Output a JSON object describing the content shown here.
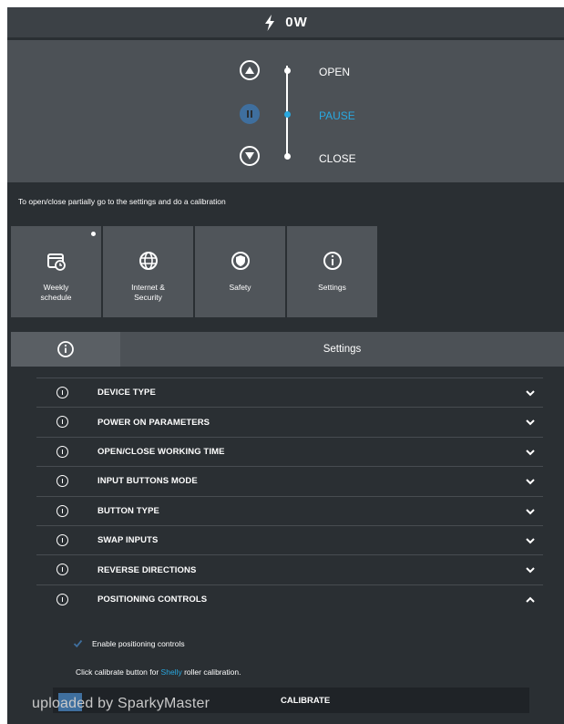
{
  "power": {
    "value": "0W"
  },
  "control": {
    "open_label": "OPEN",
    "pause_label": "PAUSE",
    "close_label": "CLOSE",
    "active": "PAUSE"
  },
  "note": "To open/close partially go to the settings and do a calibration",
  "tiles": [
    {
      "label": "Weekly\nschedule",
      "icon": "calendar-icon"
    },
    {
      "label": "Internet &\nSecurity",
      "icon": "globe-icon"
    },
    {
      "label": "Safety",
      "icon": "shield-icon"
    },
    {
      "label": "Settings",
      "icon": "info-icon"
    }
  ],
  "settings": {
    "title": "Settings",
    "items": [
      {
        "label": "DEVICE TYPE"
      },
      {
        "label": "POWER ON PARAMETERS"
      },
      {
        "label": "OPEN/CLOSE WORKING TIME"
      },
      {
        "label": "INPUT BUTTONS MODE"
      },
      {
        "label": "BUTTON TYPE"
      },
      {
        "label": "SWAP INPUTS"
      },
      {
        "label": "REVERSE DIRECTIONS"
      },
      {
        "label": "POSITIONING CONTROLS"
      }
    ]
  },
  "positioning": {
    "enable_label": "Enable positioning controls",
    "enabled": true,
    "calib_prefix": "Click calibrate button for ",
    "calib_brand": "Shelly",
    "calib_suffix": " roller calibration.",
    "calibrate_button": "CALIBRATE"
  },
  "watermark": "uploaded by SparkyMaster",
  "colors": {
    "accent": "#29a8e0",
    "panel": "#4c5156",
    "background": "#2a2f33"
  }
}
